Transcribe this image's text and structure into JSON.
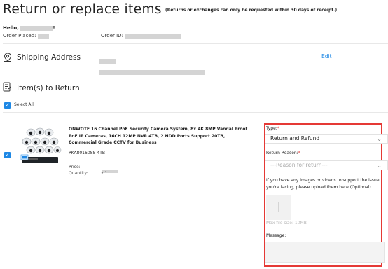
{
  "header": {
    "title": "Return or replace items",
    "note": "(Returns or exchanges can only be requested within 30 days of receipt.)",
    "hello": "Hello,",
    "hello_suffix": "!",
    "order_placed_label": "Order Placed:",
    "order_id_label": "Order ID:"
  },
  "shipping": {
    "title": "Shipping Address",
    "edit_label": "Edit",
    "icon": "location-pin-icon"
  },
  "items_section": {
    "title": "Item(s) to Return",
    "select_all_label": "Select All",
    "icon": "document-edit-icon"
  },
  "product": {
    "title": "ONWOTE 16 Channel PoE Security Camera System, 8x 4K 8MP Vandal Proof PoE IP Cameras, 16CH 12MP NVR 4TB, 2 HDD Ports Support 20TB, Commercial Grade CCTV for Business",
    "sku": "PKA801608S-4TB",
    "price_label": "Price:",
    "quantity_label": "Quantity:",
    "quantity_value": "x 1",
    "checked": true
  },
  "return_form": {
    "type_label": "Type:",
    "type_required": "*",
    "type_value": "Return and Refund",
    "reason_label": "Return Reason:",
    "reason_required": "*",
    "reason_placeholder": "---Reason for return---",
    "upload_note": "If you have any images or videos to support the issue you're facing, please upload them here (Optional)",
    "upload_symbol": "+",
    "max_size_note": "Max file size: 10MB",
    "message_label": "Message:"
  },
  "colors": {
    "accent": "#1e88e5",
    "highlight_border": "#e53935",
    "required": "#e53935"
  }
}
